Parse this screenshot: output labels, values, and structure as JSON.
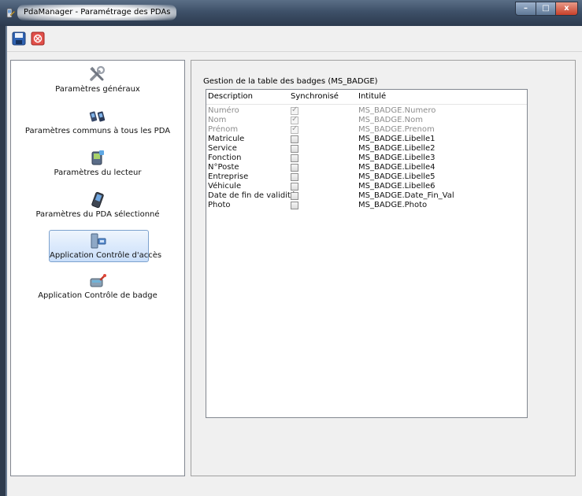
{
  "window": {
    "title": "PdaManager - Paramétrage des PDAs",
    "minimize_glyph": "–",
    "maximize_glyph": "□",
    "close_glyph": "x"
  },
  "toolbar": {
    "buttons": [
      {
        "icon": "save-icon"
      },
      {
        "icon": "cancel-icon"
      }
    ]
  },
  "nav": {
    "items": [
      {
        "label": "Paramètres généraux",
        "icon": "tools-icon"
      },
      {
        "label": "Paramètres communs à tous les PDA",
        "icon": "devices-icon"
      },
      {
        "label": "Paramètres du lecteur",
        "icon": "reader-icon"
      },
      {
        "label": "Paramètres du PDA sélectionné",
        "icon": "pda-icon"
      },
      {
        "label": "Application Contrôle d'accès",
        "icon": "access-control-icon",
        "selected": true
      },
      {
        "label": "Application Contrôle de badge",
        "icon": "badge-control-icon"
      }
    ]
  },
  "group": {
    "title": "Gestion de la table des badges (MS_BADGE)"
  },
  "grid": {
    "columns": [
      "Description",
      "Synchronisé",
      "Intitulé"
    ],
    "rows": [
      {
        "description": "Numéro",
        "synchronized": true,
        "field": "MS_BADGE.Numero",
        "enabled": false
      },
      {
        "description": "Nom",
        "synchronized": true,
        "field": "MS_BADGE.Nom",
        "enabled": false
      },
      {
        "description": "Prénom",
        "synchronized": true,
        "field": "MS_BADGE.Prenom",
        "enabled": false
      },
      {
        "description": "Matricule",
        "synchronized": false,
        "field": "MS_BADGE.Libelle1",
        "enabled": true
      },
      {
        "description": "Service",
        "synchronized": false,
        "field": "MS_BADGE.Libelle2",
        "enabled": true
      },
      {
        "description": "Fonction",
        "synchronized": false,
        "field": "MS_BADGE.Libelle3",
        "enabled": true
      },
      {
        "description": "N°Poste",
        "synchronized": false,
        "field": "MS_BADGE.Libelle4",
        "enabled": true
      },
      {
        "description": "Entreprise",
        "synchronized": false,
        "field": "MS_BADGE.Libelle5",
        "enabled": true
      },
      {
        "description": "Véhicule",
        "synchronized": false,
        "field": "MS_BADGE.Libelle6",
        "enabled": true
      },
      {
        "description": "Date de fin de validité",
        "synchronized": false,
        "field": "MS_BADGE.Date_Fin_Val",
        "enabled": true
      },
      {
        "description": "Photo",
        "synchronized": false,
        "field": "MS_BADGE.Photo",
        "enabled": true
      }
    ]
  }
}
